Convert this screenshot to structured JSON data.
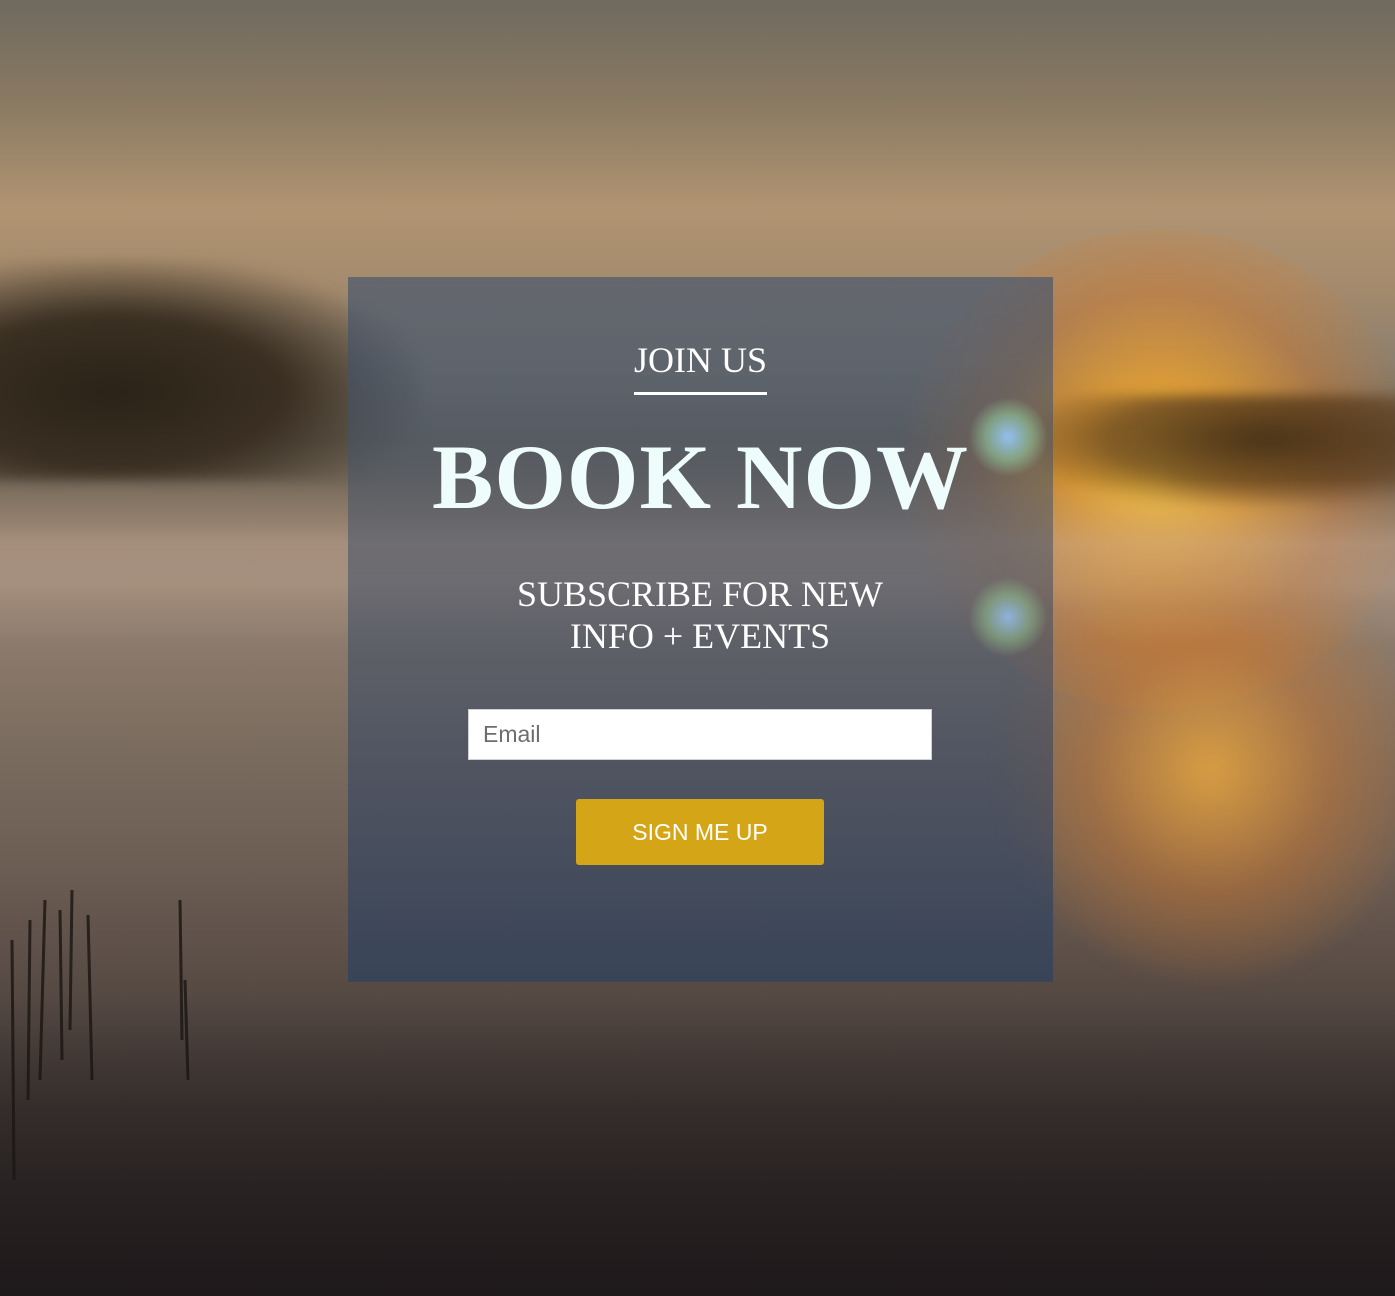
{
  "background": {
    "description_icon": "sunrise-lake-photo"
  },
  "panel": {
    "eyebrow": "JOIN US",
    "title": "BOOK NOW",
    "subtitle_line1": "SUBSCRIBE FOR NEW",
    "subtitle_line2": "INFO + EVENTS",
    "email_placeholder": "Email",
    "email_value": "",
    "button_label": "SIGN ME UP"
  },
  "colors": {
    "button": "#d4a617",
    "title": "#eefcfc",
    "text": "#ffffff"
  }
}
